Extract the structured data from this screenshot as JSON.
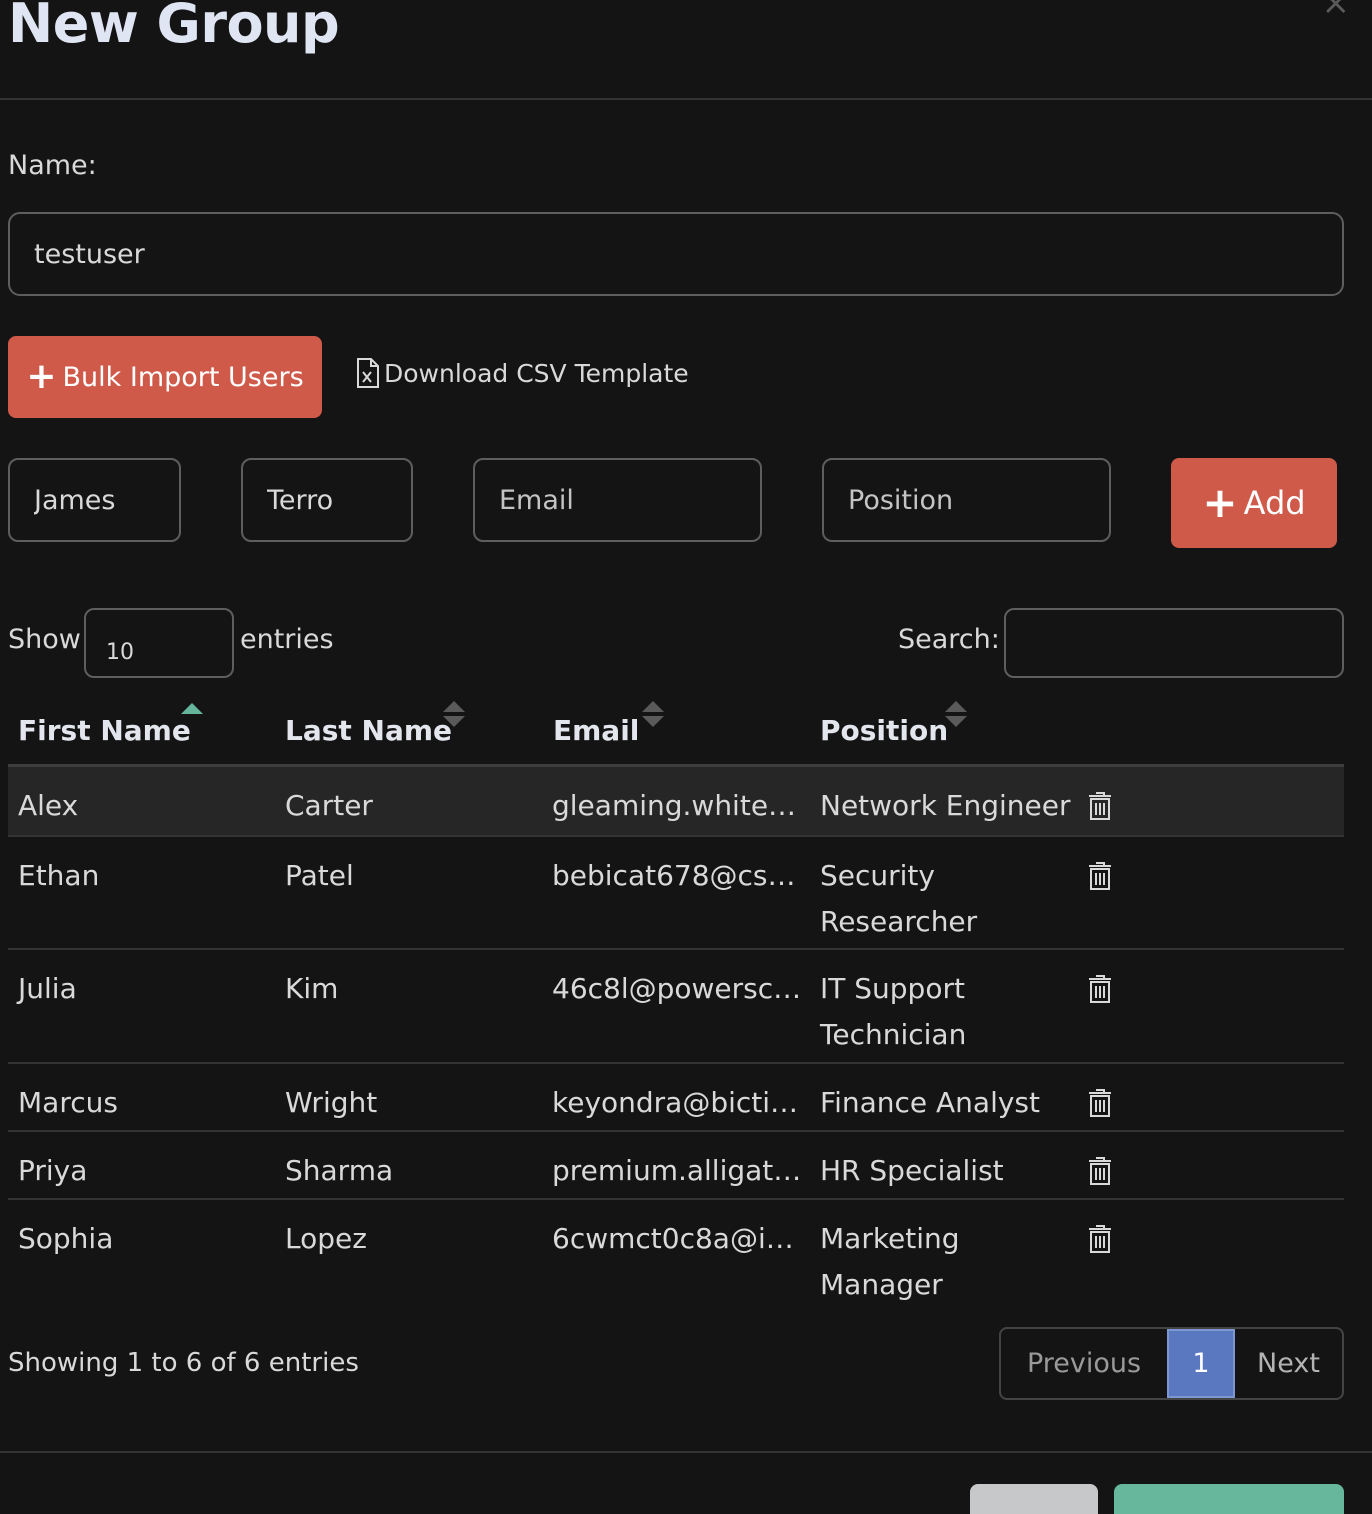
{
  "modal": {
    "title": "New Group",
    "close_glyph": "×"
  },
  "form": {
    "name_label": "Name:",
    "name_value": "testuser",
    "bulk_import_label": "Bulk Import Users",
    "download_csv_label": "Download CSV Template",
    "new_user": {
      "first_name_value": "James",
      "last_name_value": "Terro",
      "email_placeholder": "Email",
      "position_placeholder": "Position",
      "add_label": "Add"
    }
  },
  "table_controls": {
    "show_label": "Show",
    "page_length": "10",
    "entries_label": "entries",
    "search_label": "Search:"
  },
  "table": {
    "columns": [
      "First Name",
      "Last Name",
      "Email",
      "Position"
    ],
    "sorted_column": "First Name",
    "rows": [
      {
        "first": "Alex",
        "last": "Carter",
        "email": "gleaming.whitef…",
        "position": "Network Engineer"
      },
      {
        "first": "Ethan",
        "last": "Patel",
        "email": "bebicat678@cs…",
        "position": "Security Researcher"
      },
      {
        "first": "Julia",
        "last": "Kim",
        "email": "46c8l@powersc…",
        "position": "IT Support Technician"
      },
      {
        "first": "Marcus",
        "last": "Wright",
        "email": "keyondra@bicti…",
        "position": "Finance Analyst"
      },
      {
        "first": "Priya",
        "last": "Sharma",
        "email": "premium.alligat…",
        "position": "HR Specialist"
      },
      {
        "first": "Sophia",
        "last": "Lopez",
        "email": "6cwmct0c8a@i…",
        "position": "Marketing Manager"
      }
    ]
  },
  "pagination": {
    "info": "Showing 1 to 6 of 6 entries",
    "previous_label": "Previous",
    "current_page": "1",
    "next_label": "Next"
  },
  "icons": {
    "plus": "plus-icon",
    "csv": "file-excel-icon",
    "delete": "trash-icon",
    "sort": "sort-icon",
    "close": "close-icon"
  },
  "colors": {
    "background": "#141414",
    "danger": "#cf5a4a",
    "primary": "#5a78c0",
    "success": "#66b79b",
    "sort_active": "#64b59b"
  }
}
